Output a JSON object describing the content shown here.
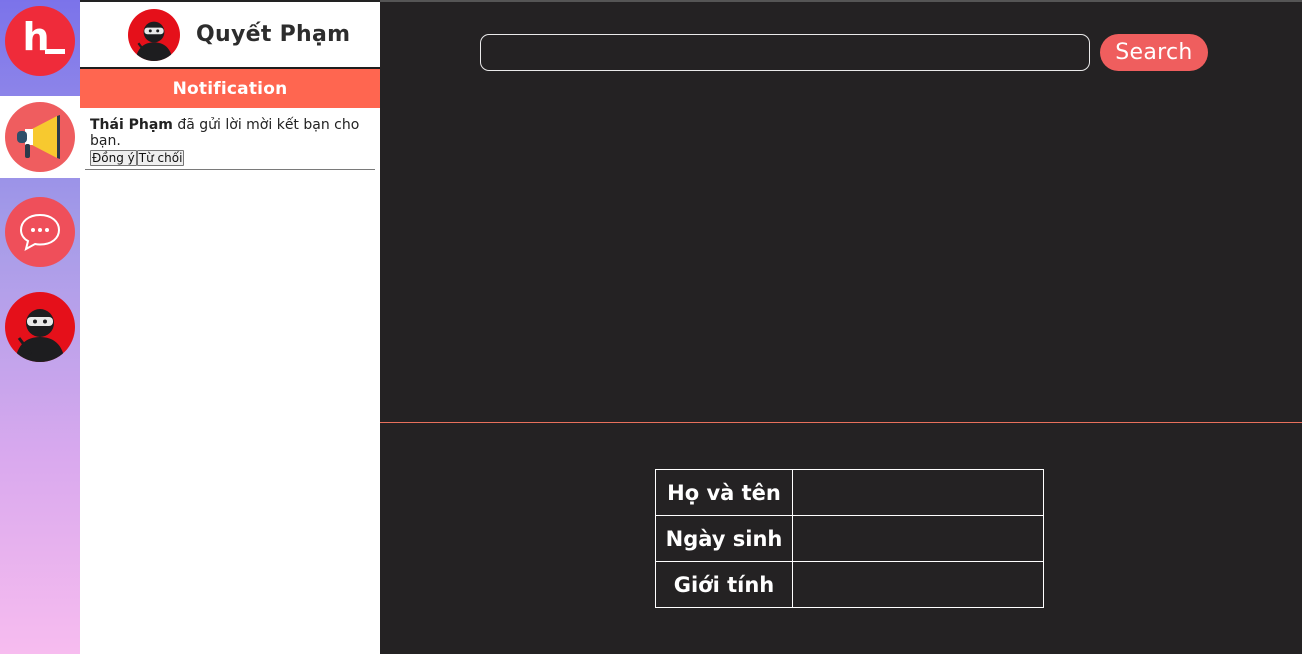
{
  "rail": {
    "logo_text": "h",
    "items": [
      {
        "name": "notifications",
        "icon": "megaphone-icon"
      },
      {
        "name": "messages",
        "icon": "chat-bubble-icon"
      },
      {
        "name": "profile",
        "icon": "ninja-avatar-icon"
      }
    ]
  },
  "user": {
    "name": "Quyết Phạm"
  },
  "panel": {
    "tab_label": "Notification",
    "notifications": [
      {
        "sender": "Thái Phạm",
        "message": " đã gửi lời mời kết bạn cho bạn.",
        "accept_label": "Đồng ý",
        "decline_label": "Từ chối"
      }
    ]
  },
  "search": {
    "value": "",
    "button_label": "Search"
  },
  "profile_info": {
    "rows": [
      {
        "label": "Họ và tên",
        "value": ""
      },
      {
        "label": "Ngày sinh",
        "value": ""
      },
      {
        "label": "Giới tính",
        "value": ""
      }
    ]
  },
  "colors": {
    "accent": "#ff6650",
    "search_button": "#ef5e5e",
    "dark_bg": "#242223",
    "logo_red": "#ef2b3a"
  }
}
